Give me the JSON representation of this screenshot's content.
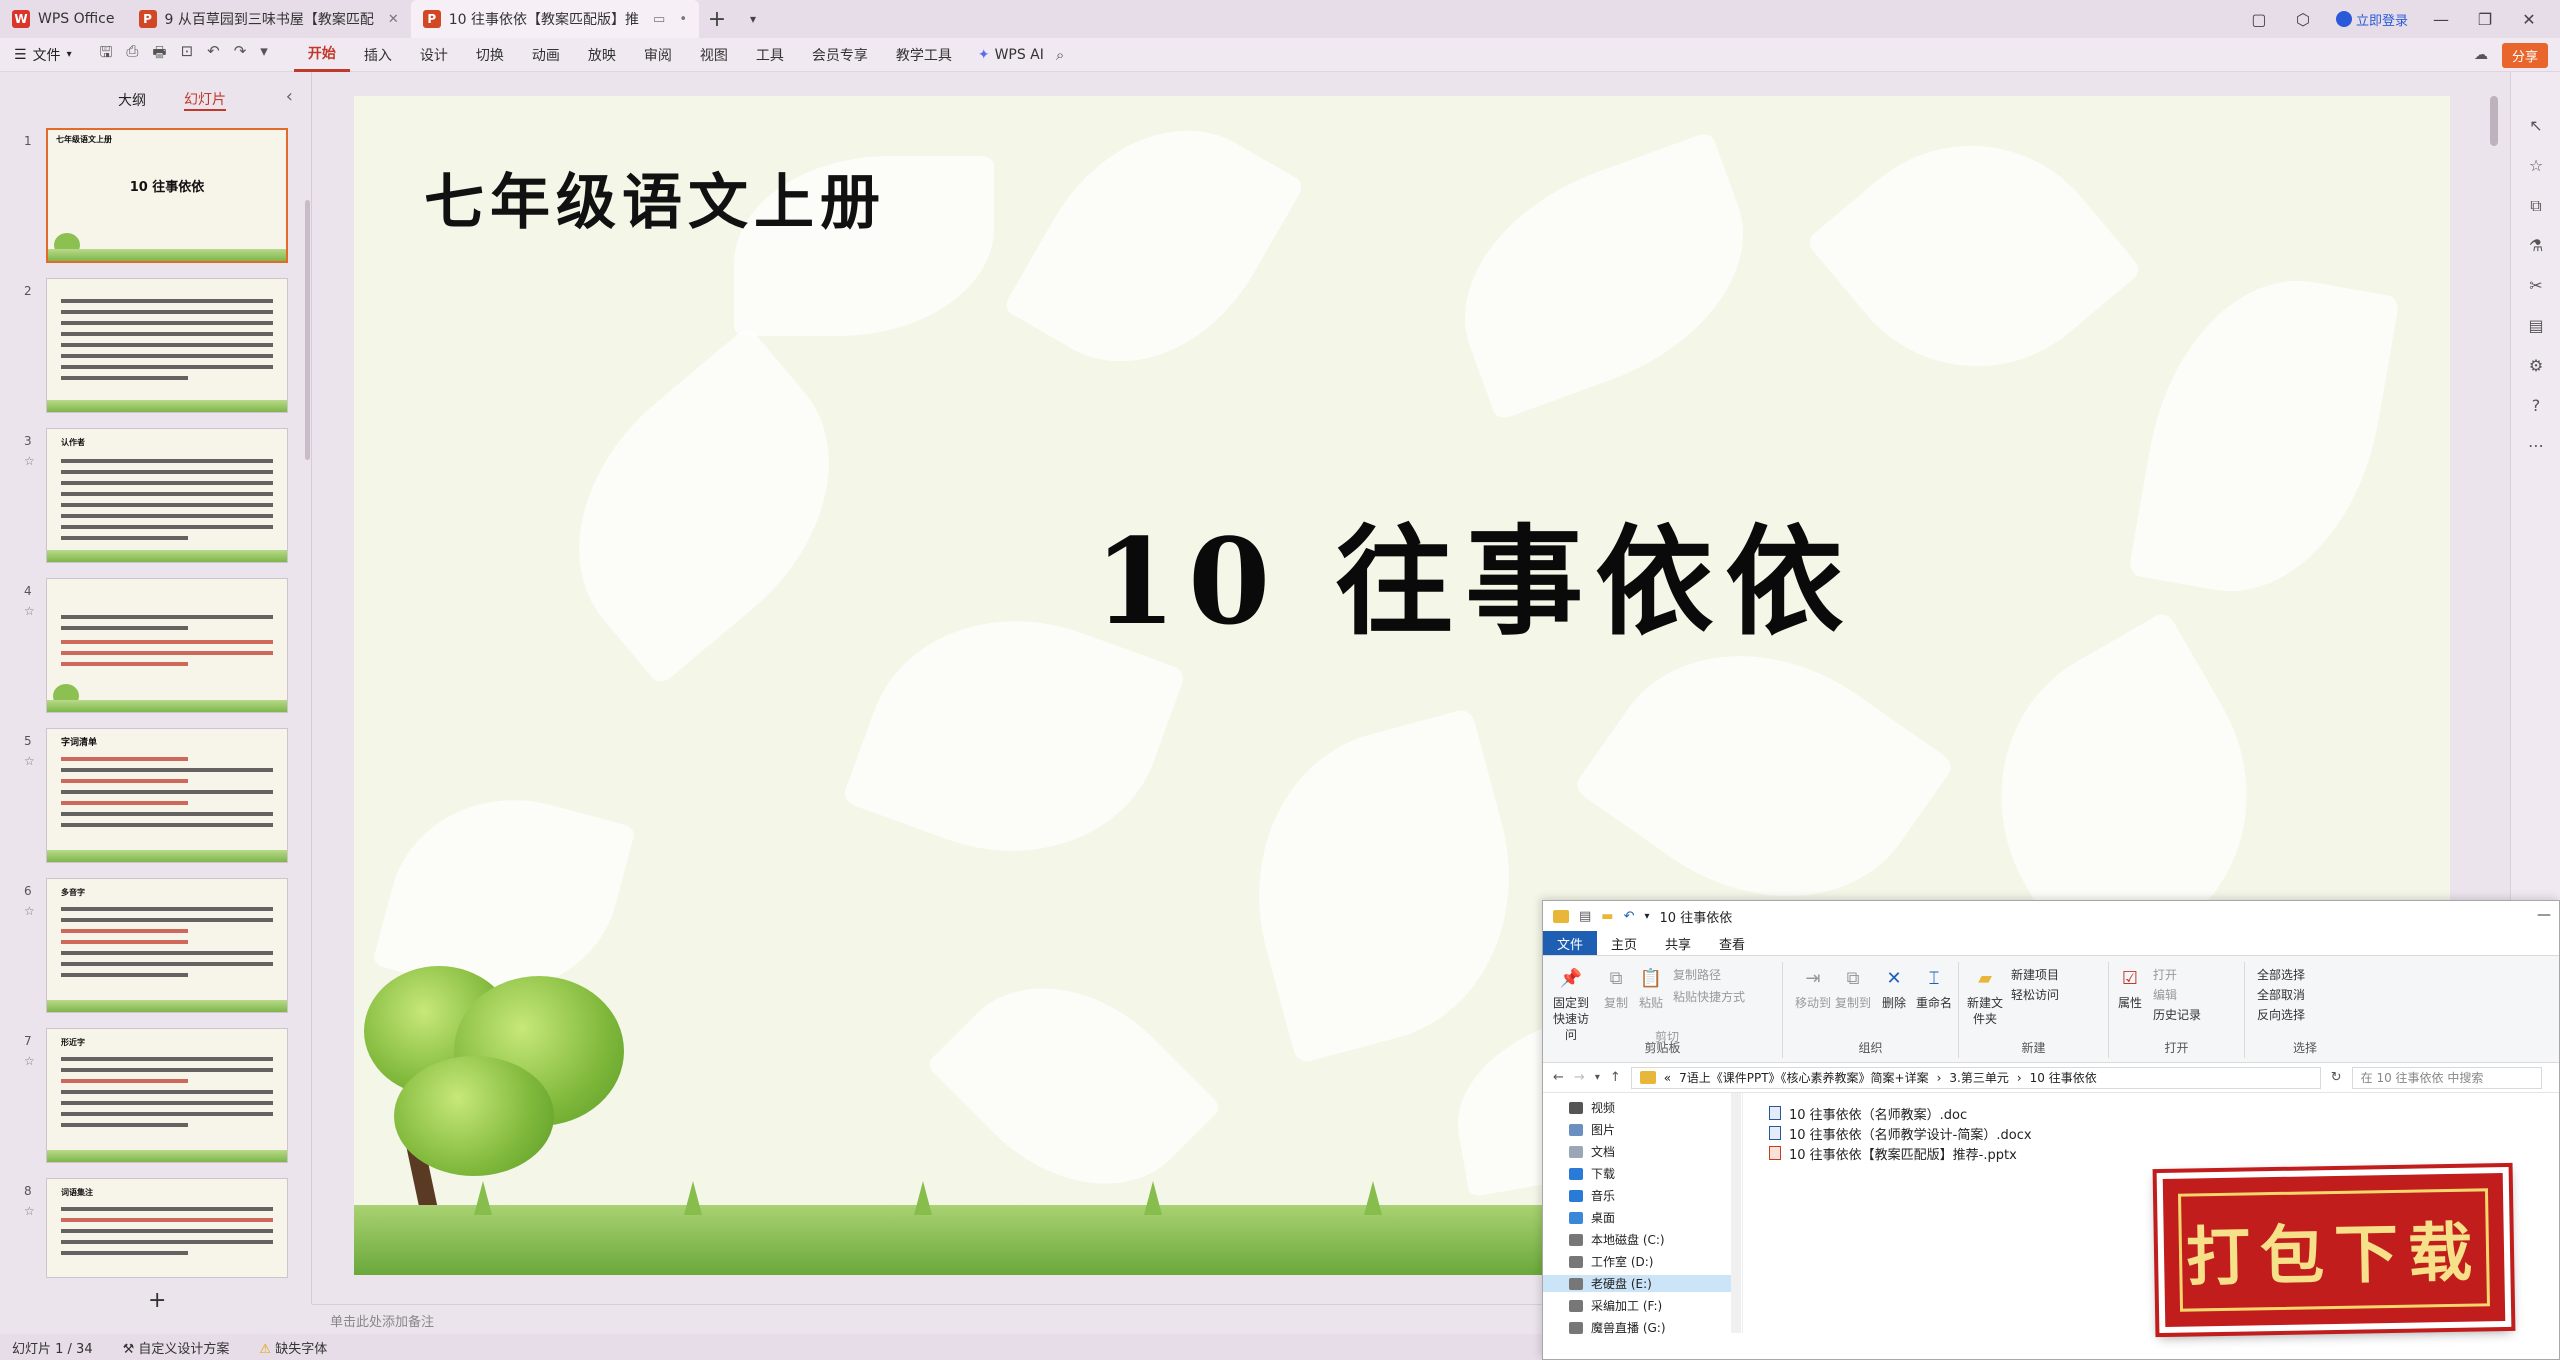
{
  "tabs": [
    {
      "label": "WPS Office",
      "logo": "W",
      "color": "#d9352b"
    },
    {
      "label": "9 从百草园到三味书屋【教案匹配",
      "logo": "P",
      "color": "#d24726"
    },
    {
      "label": "10 往事依依【教案匹配版】推",
      "logo": "P",
      "color": "#d24726"
    }
  ],
  "titlebar": {
    "login": "立即登录"
  },
  "menu": {
    "file": "文件",
    "items": [
      "开始",
      "插入",
      "设计",
      "切换",
      "动画",
      "放映",
      "审阅",
      "视图",
      "工具",
      "会员专享",
      "教学工具"
    ],
    "wps_ai": "WPS AI",
    "share": "分享"
  },
  "panel": {
    "tab_outline": "大纲",
    "tab_slides": "幻灯片"
  },
  "thumbnails": [
    {
      "num": "1",
      "head": "七年级语文上册",
      "title": "10 往事依依"
    },
    {
      "num": "2"
    },
    {
      "num": "3",
      "head": "认作者"
    },
    {
      "num": "4"
    },
    {
      "num": "5",
      "head": "字词清单"
    },
    {
      "num": "6",
      "head": "多音字"
    },
    {
      "num": "7",
      "head": "形近字"
    },
    {
      "num": "8",
      "head": "词语集注"
    }
  ],
  "slide": {
    "subtitle": "七年级语文上册",
    "title": "10  往事依依"
  },
  "notes": {
    "placeholder": "单击此处添加备注"
  },
  "status": {
    "slide_count": "幻灯片 1 / 34",
    "design_scheme": "自定义设计方案",
    "missing_fonts": "缺失字体"
  },
  "explorer": {
    "title": "10 往事依依",
    "tabs": [
      "文件",
      "主页",
      "共享",
      "查看"
    ],
    "ribbon": {
      "pin": "固定到快速访问",
      "copy": "复制",
      "paste": "粘贴",
      "copy_path": "复制路径",
      "paste_shortcut": "粘贴快捷方式",
      "cut": "剪切",
      "clipboard": "剪贴板",
      "move_to": "移动到",
      "copy_to": "复制到",
      "delete": "删除",
      "rename": "重命名",
      "organize": "组织",
      "new_folder": "新建文件夹",
      "new_item": "新建项目",
      "easy_access": "轻松访问",
      "new": "新建",
      "properties": "属性",
      "open": "打开",
      "edit": "编辑",
      "history": "历史记录",
      "open_group": "打开",
      "select_all": "全部选择",
      "select_none": "全部取消",
      "invert": "反向选择",
      "select_group": "选择"
    },
    "path": [
      "7语上《课件PPT》《核心素养教案》简案+详案",
      "3.第三单元",
      "10 往事依依"
    ],
    "search_placeholder": "在 10 往事依依 中搜索",
    "nav": [
      "视频",
      "图片",
      "文档",
      "下载",
      "音乐",
      "桌面",
      "本地磁盘 (C:)",
      "工作室 (D:)",
      "老硬盘 (E:)",
      "采编加工 (F:)",
      "魔兽直播 (G:)"
    ],
    "files": [
      {
        "name": "10 往事依依（名师教案）.doc",
        "type": "doc"
      },
      {
        "name": "10 往事依依（名师教学设计-简案）.docx",
        "type": "doc"
      },
      {
        "name": "10 往事依依【教案匹配版】推荐-.pptx",
        "type": "ppt"
      }
    ]
  },
  "badge": {
    "text": "打包下载"
  }
}
